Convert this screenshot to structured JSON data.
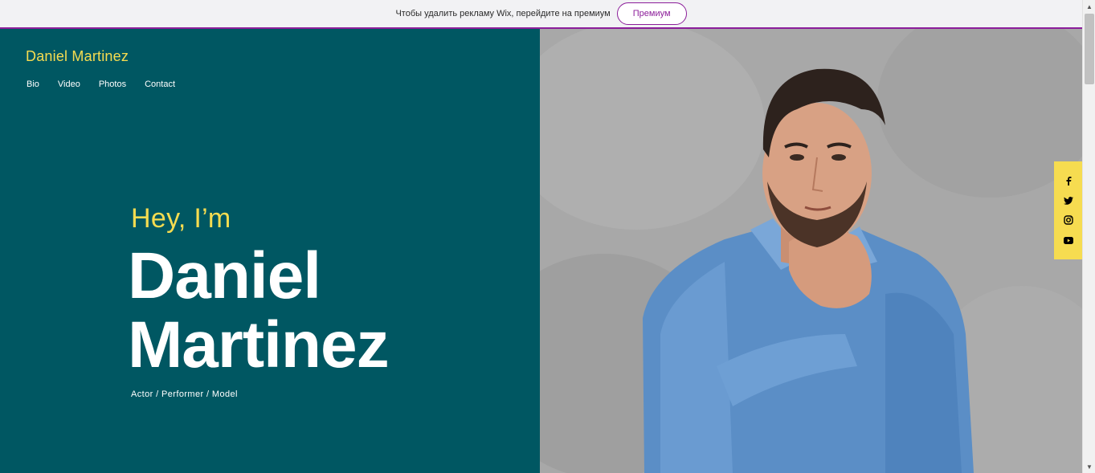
{
  "ad_banner": {
    "text": "Чтобы удалить рекламу Wix, перейдите на премиум",
    "button_label": "Премиум",
    "accent_color": "#8c1e9a"
  },
  "site": {
    "title": "Daniel Martinez",
    "nav": [
      "Bio",
      "Video",
      "Photos",
      "Contact"
    ]
  },
  "hero": {
    "greeting": "Hey, I’m",
    "name_line1": "Daniel",
    "name_line2": "Martinez",
    "roles": "Actor / Performer / Model",
    "panel_color": "#005762",
    "accent_color": "#f6dc50"
  },
  "social": {
    "icons": [
      "facebook-icon",
      "twitter-icon",
      "instagram-icon",
      "youtube-icon"
    ],
    "bar_color": "#f6dc50"
  },
  "scrollbar": {
    "up_glyph": "▲",
    "down_glyph": "▼"
  }
}
